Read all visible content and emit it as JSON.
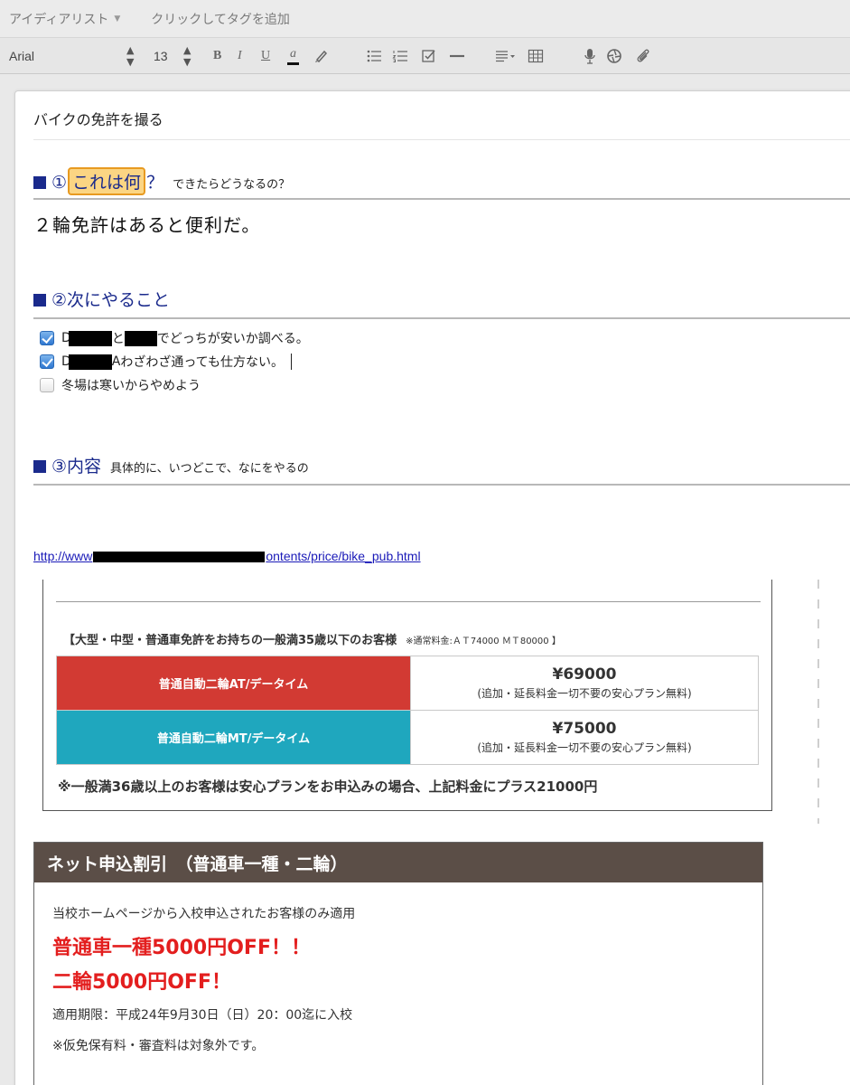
{
  "notebar": {
    "notebook": "アイディアリスト",
    "tags_placeholder": "クリックしてタグを追加"
  },
  "toolbar": {
    "font": "Arial",
    "size": "13",
    "bold": "B",
    "italic": "I",
    "underline": "U",
    "color": "a",
    "icons": [
      "highlighter-icon",
      "bullet-list-icon",
      "numbered-list-icon",
      "checkbox-icon",
      "horizontal-rule-icon",
      "align-icon",
      "table-icon",
      "microphone-icon",
      "camera-icon",
      "attachment-icon"
    ]
  },
  "note": {
    "title": "バイクの免許を撮る",
    "section1": {
      "prefix": "①",
      "highlight": "これは何",
      "suffix": "？",
      "sub": "できたらどうなるの？",
      "body": "２輪免許はあると便利だ。"
    },
    "section2": {
      "heading": "②次にやること",
      "todos": [
        {
          "checked": true,
          "a": "D",
          "b": "と",
          "c": "でどっちが安いか調べる。"
        },
        {
          "checked": true,
          "a": "D",
          "b": "A",
          "c": "わざわざ通っても仕方ない。"
        },
        {
          "checked": false,
          "text": "冬場は寒いからやめよう"
        }
      ]
    },
    "section3": {
      "heading": "③内容",
      "sub": "具体的に、いつどこで、なにをやるの"
    },
    "link": {
      "prefix": "http://www",
      "suffix": "ontents/price/bike_pub.html"
    }
  },
  "capture": {
    "price_heading": "【大型・中型・普通車免許をお持ちの一般満35歳以下のお客様",
    "price_heading_small": "※通常料金:ＡＴ74000 ＭＴ80000 】",
    "plans": [
      {
        "name": "普通自動二輪AT/データイム",
        "price": "¥69000",
        "note": "(追加・延長料金一切不要の安心プラン無料)",
        "color": "#d23a33"
      },
      {
        "name": "普通自動二輪MT/データイム",
        "price": "¥75000",
        "note": "(追加・延長料金一切不要の安心プラン無料)",
        "color": "#1fa7be"
      }
    ],
    "footnote": "※一般満36歳以上のお客様は安心プランをお申込みの場合、上記料金にプラス21000円",
    "net": {
      "title": "ネット申込割引　（普通車一種・二輪）",
      "line1": "当校ホームページから入校申込されたお客様のみ適用",
      "offer1": "普通車一種5000円OFF！！",
      "offer2": "二輪5000円OFF！",
      "period": "適用期限：平成24年9月30日（日）20：00迄に入校",
      "note": "※仮免保有料・審査料は対象外です。"
    }
  }
}
